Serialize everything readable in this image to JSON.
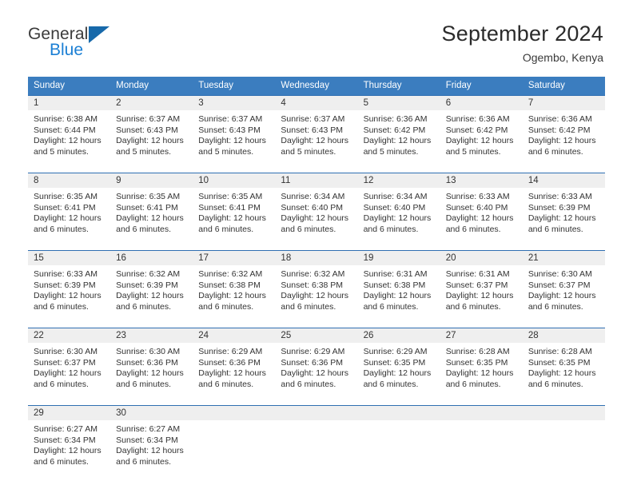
{
  "logo": {
    "word1": "General",
    "word2": "Blue",
    "triangle_color": "#1769aa"
  },
  "header": {
    "title": "September 2024",
    "subtitle": "Ogembo, Kenya",
    "accent_color": "#3b7dbf"
  },
  "weekday_headers": [
    "Sunday",
    "Monday",
    "Tuesday",
    "Wednesday",
    "Thursday",
    "Friday",
    "Saturday"
  ],
  "labels": {
    "sunrise": "Sunrise:",
    "sunset": "Sunset:",
    "daylight": "Daylight:"
  },
  "weeks": [
    [
      {
        "day": "1",
        "sunrise": "Sunrise: 6:38 AM",
        "sunset": "Sunset: 6:44 PM",
        "daylight1": "Daylight: 12 hours",
        "daylight2": "and 5 minutes."
      },
      {
        "day": "2",
        "sunrise": "Sunrise: 6:37 AM",
        "sunset": "Sunset: 6:43 PM",
        "daylight1": "Daylight: 12 hours",
        "daylight2": "and 5 minutes."
      },
      {
        "day": "3",
        "sunrise": "Sunrise: 6:37 AM",
        "sunset": "Sunset: 6:43 PM",
        "daylight1": "Daylight: 12 hours",
        "daylight2": "and 5 minutes."
      },
      {
        "day": "4",
        "sunrise": "Sunrise: 6:37 AM",
        "sunset": "Sunset: 6:43 PM",
        "daylight1": "Daylight: 12 hours",
        "daylight2": "and 5 minutes."
      },
      {
        "day": "5",
        "sunrise": "Sunrise: 6:36 AM",
        "sunset": "Sunset: 6:42 PM",
        "daylight1": "Daylight: 12 hours",
        "daylight2": "and 5 minutes."
      },
      {
        "day": "6",
        "sunrise": "Sunrise: 6:36 AM",
        "sunset": "Sunset: 6:42 PM",
        "daylight1": "Daylight: 12 hours",
        "daylight2": "and 5 minutes."
      },
      {
        "day": "7",
        "sunrise": "Sunrise: 6:36 AM",
        "sunset": "Sunset: 6:42 PM",
        "daylight1": "Daylight: 12 hours",
        "daylight2": "and 6 minutes."
      }
    ],
    [
      {
        "day": "8",
        "sunrise": "Sunrise: 6:35 AM",
        "sunset": "Sunset: 6:41 PM",
        "daylight1": "Daylight: 12 hours",
        "daylight2": "and 6 minutes."
      },
      {
        "day": "9",
        "sunrise": "Sunrise: 6:35 AM",
        "sunset": "Sunset: 6:41 PM",
        "daylight1": "Daylight: 12 hours",
        "daylight2": "and 6 minutes."
      },
      {
        "day": "10",
        "sunrise": "Sunrise: 6:35 AM",
        "sunset": "Sunset: 6:41 PM",
        "daylight1": "Daylight: 12 hours",
        "daylight2": "and 6 minutes."
      },
      {
        "day": "11",
        "sunrise": "Sunrise: 6:34 AM",
        "sunset": "Sunset: 6:40 PM",
        "daylight1": "Daylight: 12 hours",
        "daylight2": "and 6 minutes."
      },
      {
        "day": "12",
        "sunrise": "Sunrise: 6:34 AM",
        "sunset": "Sunset: 6:40 PM",
        "daylight1": "Daylight: 12 hours",
        "daylight2": "and 6 minutes."
      },
      {
        "day": "13",
        "sunrise": "Sunrise: 6:33 AM",
        "sunset": "Sunset: 6:40 PM",
        "daylight1": "Daylight: 12 hours",
        "daylight2": "and 6 minutes."
      },
      {
        "day": "14",
        "sunrise": "Sunrise: 6:33 AM",
        "sunset": "Sunset: 6:39 PM",
        "daylight1": "Daylight: 12 hours",
        "daylight2": "and 6 minutes."
      }
    ],
    [
      {
        "day": "15",
        "sunrise": "Sunrise: 6:33 AM",
        "sunset": "Sunset: 6:39 PM",
        "daylight1": "Daylight: 12 hours",
        "daylight2": "and 6 minutes."
      },
      {
        "day": "16",
        "sunrise": "Sunrise: 6:32 AM",
        "sunset": "Sunset: 6:39 PM",
        "daylight1": "Daylight: 12 hours",
        "daylight2": "and 6 minutes."
      },
      {
        "day": "17",
        "sunrise": "Sunrise: 6:32 AM",
        "sunset": "Sunset: 6:38 PM",
        "daylight1": "Daylight: 12 hours",
        "daylight2": "and 6 minutes."
      },
      {
        "day": "18",
        "sunrise": "Sunrise: 6:32 AM",
        "sunset": "Sunset: 6:38 PM",
        "daylight1": "Daylight: 12 hours",
        "daylight2": "and 6 minutes."
      },
      {
        "day": "19",
        "sunrise": "Sunrise: 6:31 AM",
        "sunset": "Sunset: 6:38 PM",
        "daylight1": "Daylight: 12 hours",
        "daylight2": "and 6 minutes."
      },
      {
        "day": "20",
        "sunrise": "Sunrise: 6:31 AM",
        "sunset": "Sunset: 6:37 PM",
        "daylight1": "Daylight: 12 hours",
        "daylight2": "and 6 minutes."
      },
      {
        "day": "21",
        "sunrise": "Sunrise: 6:30 AM",
        "sunset": "Sunset: 6:37 PM",
        "daylight1": "Daylight: 12 hours",
        "daylight2": "and 6 minutes."
      }
    ],
    [
      {
        "day": "22",
        "sunrise": "Sunrise: 6:30 AM",
        "sunset": "Sunset: 6:37 PM",
        "daylight1": "Daylight: 12 hours",
        "daylight2": "and 6 minutes."
      },
      {
        "day": "23",
        "sunrise": "Sunrise: 6:30 AM",
        "sunset": "Sunset: 6:36 PM",
        "daylight1": "Daylight: 12 hours",
        "daylight2": "and 6 minutes."
      },
      {
        "day": "24",
        "sunrise": "Sunrise: 6:29 AM",
        "sunset": "Sunset: 6:36 PM",
        "daylight1": "Daylight: 12 hours",
        "daylight2": "and 6 minutes."
      },
      {
        "day": "25",
        "sunrise": "Sunrise: 6:29 AM",
        "sunset": "Sunset: 6:36 PM",
        "daylight1": "Daylight: 12 hours",
        "daylight2": "and 6 minutes."
      },
      {
        "day": "26",
        "sunrise": "Sunrise: 6:29 AM",
        "sunset": "Sunset: 6:35 PM",
        "daylight1": "Daylight: 12 hours",
        "daylight2": "and 6 minutes."
      },
      {
        "day": "27",
        "sunrise": "Sunrise: 6:28 AM",
        "sunset": "Sunset: 6:35 PM",
        "daylight1": "Daylight: 12 hours",
        "daylight2": "and 6 minutes."
      },
      {
        "day": "28",
        "sunrise": "Sunrise: 6:28 AM",
        "sunset": "Sunset: 6:35 PM",
        "daylight1": "Daylight: 12 hours",
        "daylight2": "and 6 minutes."
      }
    ],
    [
      {
        "day": "29",
        "sunrise": "Sunrise: 6:27 AM",
        "sunset": "Sunset: 6:34 PM",
        "daylight1": "Daylight: 12 hours",
        "daylight2": "and 6 minutes."
      },
      {
        "day": "30",
        "sunrise": "Sunrise: 6:27 AM",
        "sunset": "Sunset: 6:34 PM",
        "daylight1": "Daylight: 12 hours",
        "daylight2": "and 6 minutes."
      },
      {
        "day": "",
        "sunrise": "",
        "sunset": "",
        "daylight1": "",
        "daylight2": ""
      },
      {
        "day": "",
        "sunrise": "",
        "sunset": "",
        "daylight1": "",
        "daylight2": ""
      },
      {
        "day": "",
        "sunrise": "",
        "sunset": "",
        "daylight1": "",
        "daylight2": ""
      },
      {
        "day": "",
        "sunrise": "",
        "sunset": "",
        "daylight1": "",
        "daylight2": ""
      },
      {
        "day": "",
        "sunrise": "",
        "sunset": "",
        "daylight1": "",
        "daylight2": ""
      }
    ]
  ]
}
